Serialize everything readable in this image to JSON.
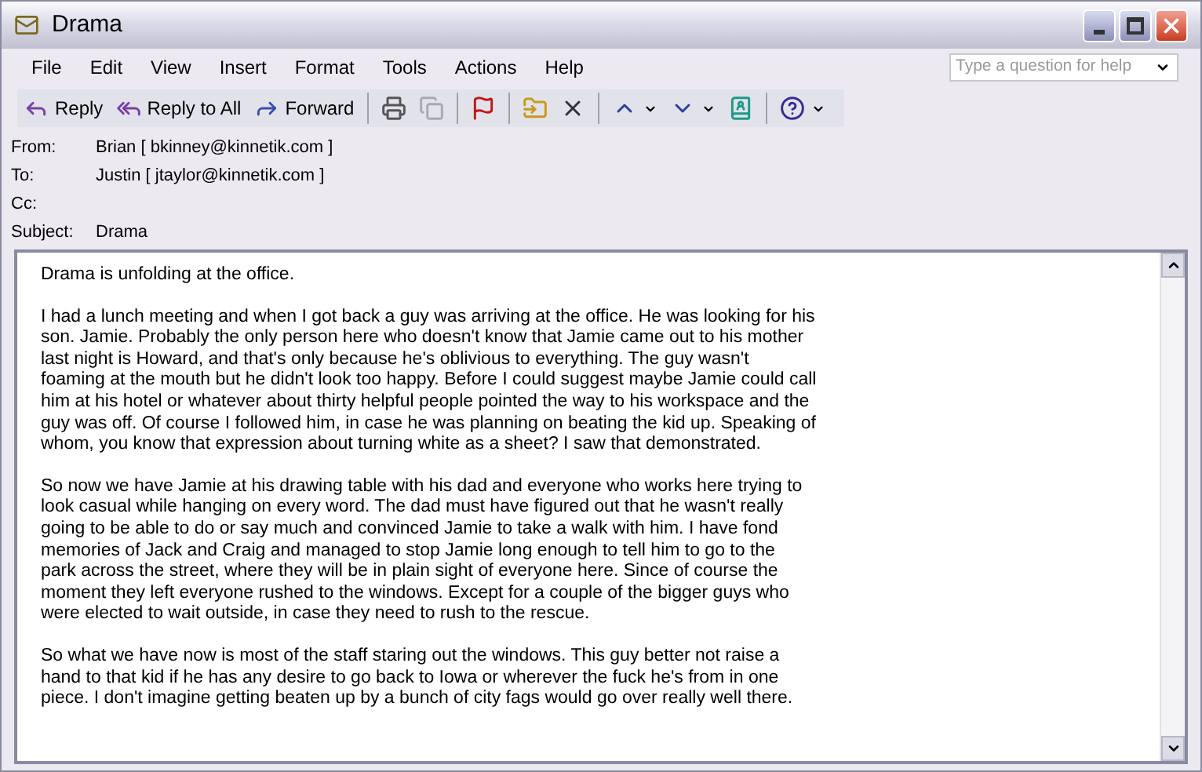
{
  "window": {
    "title": "Drama"
  },
  "menu": [
    "File",
    "Edit",
    "View",
    "Insert",
    "Format",
    "Tools",
    "Actions",
    "Help"
  ],
  "help_search": {
    "placeholder": "Type a question for help"
  },
  "toolbar": [
    {
      "kind": "reply",
      "label": "Reply"
    },
    {
      "kind": "reply_all",
      "label": "Reply to All"
    },
    {
      "kind": "forward",
      "label": "Forward"
    },
    {
      "kind": "print"
    },
    {
      "kind": "copy",
      "disabled": true
    },
    {
      "kind": "flag"
    },
    {
      "kind": "move"
    },
    {
      "kind": "delete"
    },
    {
      "kind": "previous"
    },
    {
      "kind": "next"
    },
    {
      "kind": "address_book"
    },
    {
      "kind": "help"
    }
  ],
  "headers": [
    {
      "label": "From:",
      "value": "Brian [ bkinney@kinnetik.com ]"
    },
    {
      "label": "To:",
      "value": "Justin [ jtaylor@kinnetik.com ]"
    },
    {
      "label": "Cc:"
    },
    {
      "label": "Subject:",
      "value": "Drama"
    }
  ],
  "body": [
    [
      "Drama is unfolding at the office."
    ],
    [
      "I had a lunch meeting and when I got back a guy was arriving at the office. He was looking for his",
      "son. Jamie. Probably the only person here who doesn't know that Jamie came out to his mother",
      "last night is Howard, and that's only because he's oblivious to everything. The guy wasn't",
      "foaming at the mouth but he didn't look too happy. Before I could suggest maybe Jamie could call",
      "him at his hotel or whatever about thirty helpful people pointed the way to his workspace and the",
      "guy was off. Of course I followed him, in case he was planning on beating the kid up. Speaking of",
      "whom, you know that expression about turning white as a sheet? I saw that demonstrated."
    ],
    [
      "So now we have Jamie at his drawing table with his dad and everyone who works here trying to",
      "look casual while hanging on every word. The dad must have figured out that he wasn't really",
      "going to be able to do or say much and convinced Jamie to take a walk with him. I have fond",
      "memories of Jack and Craig and managed to stop Jamie long enough to tell him to go to the",
      "park across the street, where they will be in plain sight of everyone here. Since of course the",
      "moment they left everyone rushed to the windows. Except for a couple of the bigger guys who",
      "were elected to wait outside, in case they need to rush to the rescue."
    ],
    [
      "So what we have now is most of the staff staring out the windows. This guy better not raise a",
      "hand to that kid if he has any desire to go back to Iowa or wherever the fuck he's from in one",
      "piece. I don't imagine getting beaten up by a bunch of city fags would go over really well there."
    ]
  ]
}
